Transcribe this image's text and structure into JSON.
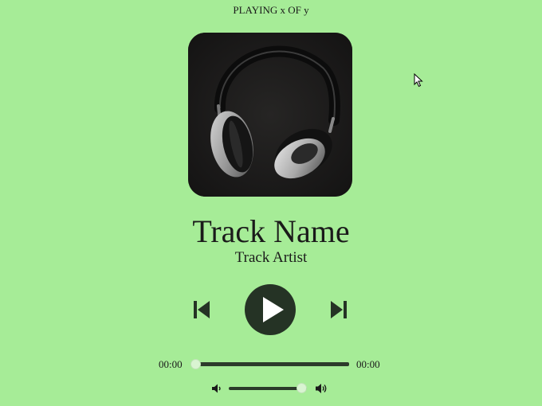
{
  "header": {
    "now_playing": "PLAYING x OF y"
  },
  "album_art": {
    "alt": "headphones"
  },
  "track": {
    "name": "Track Name",
    "artist": "Track Artist"
  },
  "controls": {
    "prev_icon": "skip-previous-icon",
    "play_icon": "play-icon",
    "next_icon": "skip-next-icon"
  },
  "seek": {
    "current_time": "00:00",
    "total_time": "00:00",
    "progress": 0
  },
  "volume": {
    "level": 0.93,
    "down_icon": "volume-down-icon",
    "up_icon": "volume-up-icon"
  },
  "colors": {
    "background": "#a6ec97",
    "control_dark": "#253325",
    "slider_thumb": "#d9f4d2"
  }
}
